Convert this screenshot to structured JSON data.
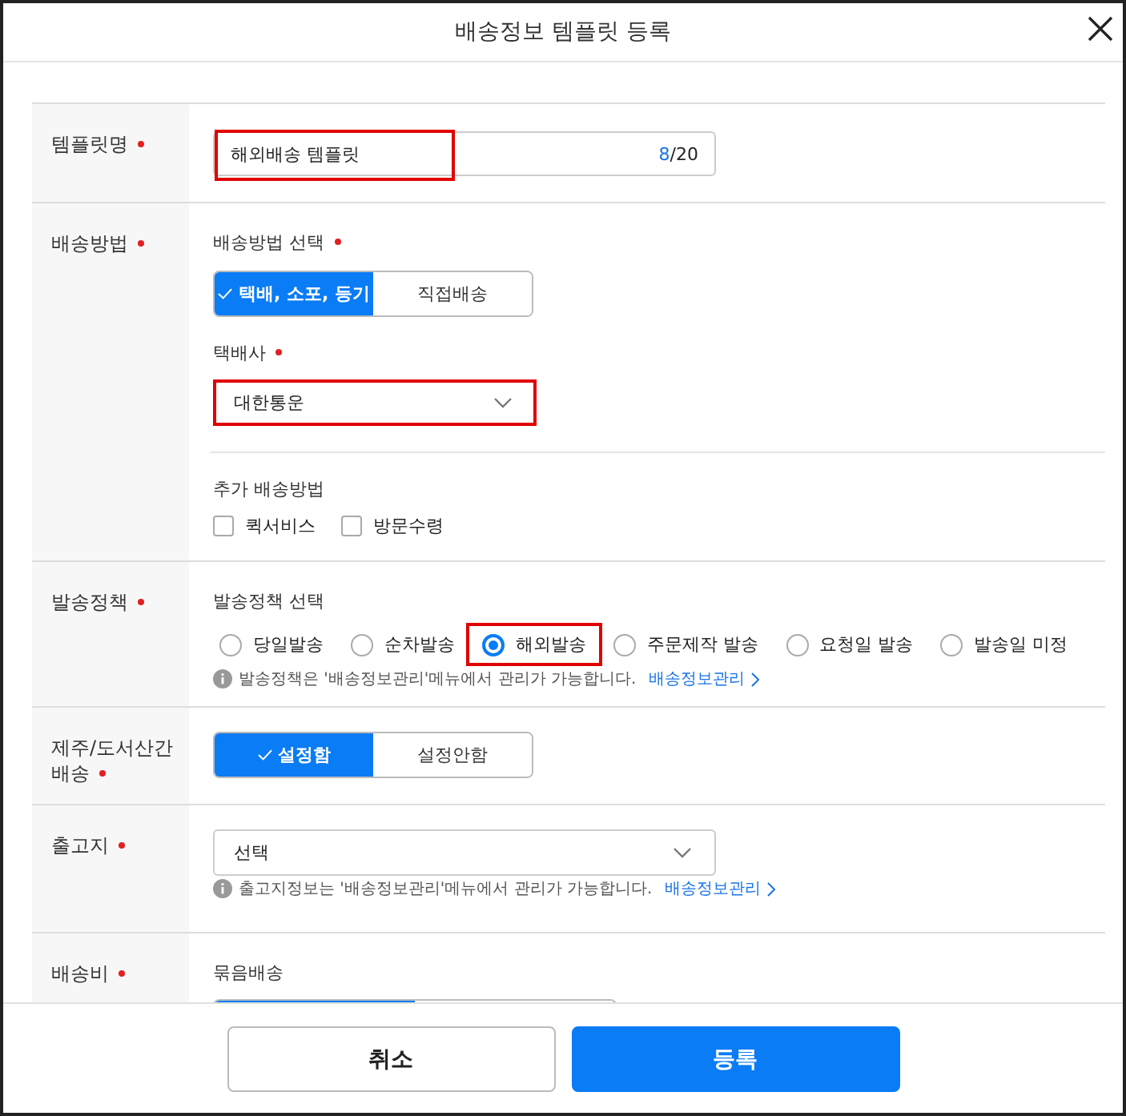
{
  "window": {
    "title": "배송정보 템플릿 등록"
  },
  "template_name": {
    "label": "템플릿명",
    "required": true,
    "value": "해외배송 템플릿",
    "count": "8",
    "limit": "/20",
    "highlighted": true
  },
  "shipping_method": {
    "label": "배송방법",
    "required": true,
    "choice_label": "배송방법 선택",
    "choice_required": true,
    "options": [
      {
        "label": "택배, 소포, 등기",
        "selected": true
      },
      {
        "label": "직접배송",
        "selected": false
      }
    ],
    "courier_label": "택배사",
    "courier_required": true,
    "courier": {
      "value": "대한통운",
      "highlighted": true
    },
    "extra_label": "추가 배송방법",
    "extras": [
      {
        "label": "퀵서비스",
        "checked": false
      },
      {
        "label": "방문수령",
        "checked": false
      }
    ]
  },
  "dispatch_policy": {
    "label": "발송정책",
    "required": true,
    "choice_label": "발송정책 선택",
    "options": [
      {
        "label": "당일발송",
        "selected": false,
        "highlighted": false
      },
      {
        "label": "순차발송",
        "selected": false,
        "highlighted": false
      },
      {
        "label": "해외발송",
        "selected": true,
        "highlighted": true
      },
      {
        "label": "주문제작 발송",
        "selected": false,
        "highlighted": false
      },
      {
        "label": "요청일 발송",
        "selected": false,
        "highlighted": false
      },
      {
        "label": "발송일 미정",
        "selected": false,
        "highlighted": false
      }
    ],
    "info": "발송정책은 '배송정보관리'메뉴에서 관리가 가능합니다.",
    "link": "배송정보관리"
  },
  "island_shipping": {
    "label": "제주/도서산간 배송",
    "required": true,
    "options": [
      {
        "label": "설정함",
        "selected": true
      },
      {
        "label": "설정안함",
        "selected": false
      }
    ]
  },
  "warehouse": {
    "label": "출고지",
    "required": true,
    "value": "선택",
    "info": "출고지정보는 '배송정보관리'메뉴에서 관리가 가능합니다.",
    "link": "배송정보관리"
  },
  "shipping_fee": {
    "label": "배송비",
    "required": true,
    "sub_label": "묶음배송",
    "segments": [
      {
        "selected": true
      },
      {
        "selected": false
      }
    ]
  },
  "buttons": [
    {
      "label": "취소",
      "kind": "secondary"
    },
    {
      "label": "등록",
      "kind": "primary"
    }
  ]
}
